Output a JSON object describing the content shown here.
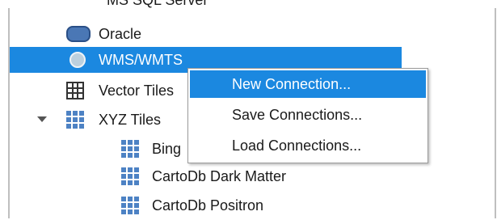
{
  "tree": {
    "partial_top_label": "MS SQL Server",
    "items": [
      {
        "label": "Oracle",
        "icon": "oracle-database-icon"
      },
      {
        "label": "WMS/WMTS",
        "icon": "globe-icon",
        "selected": true
      },
      {
        "label": "Vector Tiles",
        "icon": "grid-icon"
      },
      {
        "label": "XYZ Tiles",
        "icon": "xyz-tiles-icon",
        "expanded": true
      },
      {
        "label": "Bing",
        "icon": "tile-grid-icon"
      },
      {
        "label": "CartoDb Dark Matter",
        "icon": "tile-grid-icon"
      },
      {
        "label": "CartoDb Positron",
        "icon": "tile-grid-icon"
      }
    ]
  },
  "context_menu": {
    "items": [
      {
        "label": "New Connection...",
        "highlighted": true
      },
      {
        "label": "Save Connections..."
      },
      {
        "label": "Load Connections..."
      }
    ]
  },
  "colors": {
    "selection": "#1b88e0",
    "tile_icon": "#4d82c4"
  }
}
